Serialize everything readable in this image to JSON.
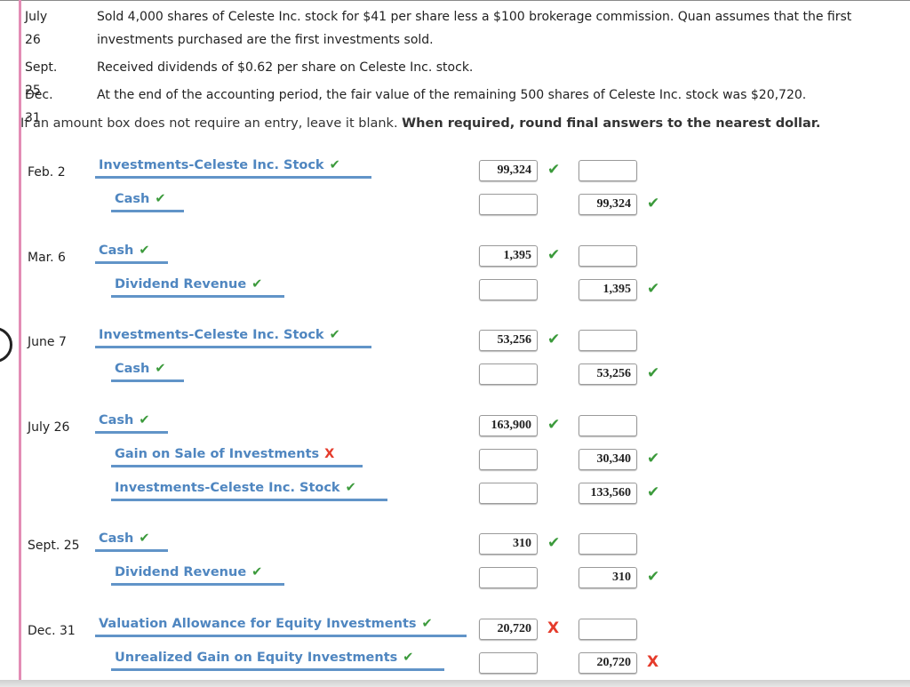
{
  "events": [
    {
      "date": "July 26",
      "text": "Sold 4,000 shares of Celeste Inc. stock for $41 per share less a $100 brokerage commission. Quan assumes that the first investments purchased are the first investments sold."
    },
    {
      "date": "Sept. 25",
      "text": "Received dividends of $0.62 per share on Celeste Inc. stock."
    },
    {
      "date": "Dec. 31",
      "text": "At the end of the accounting period, the fair value of the remaining 500 shares of Celeste Inc. stock was $20,720."
    }
  ],
  "instructions": {
    "normal": "If an amount box does not require an entry, leave it blank. ",
    "bold": "When required, round final answers to the nearest dollar."
  },
  "icons": {
    "check": "✔",
    "cross": "X"
  },
  "colors": {
    "account_text": "#4f86c0",
    "underline": "#6194c8",
    "correct": "#3b9a3b",
    "incorrect": "#e53b2b",
    "sidebar": "#e38cb5"
  },
  "journal": [
    {
      "date": "Feb. 2",
      "lines": [
        {
          "account": "Investments-Celeste Inc. Stock",
          "account_status": "correct",
          "debit": "99,324",
          "credit": "",
          "amount_status": "correct"
        },
        {
          "account": "Cash",
          "account_status": "correct",
          "debit": "",
          "credit": "99,324",
          "amount_status": "correct"
        }
      ]
    },
    {
      "date": "Mar. 6",
      "lines": [
        {
          "account": "Cash",
          "account_status": "correct",
          "debit": "1,395",
          "credit": "",
          "amount_status": "correct"
        },
        {
          "account": "Dividend Revenue",
          "account_status": "correct",
          "debit": "",
          "credit": "1,395",
          "amount_status": "correct"
        }
      ]
    },
    {
      "date": "June 7",
      "lines": [
        {
          "account": "Investments-Celeste Inc. Stock",
          "account_status": "correct",
          "debit": "53,256",
          "credit": "",
          "amount_status": "correct"
        },
        {
          "account": "Cash",
          "account_status": "correct",
          "debit": "",
          "credit": "53,256",
          "amount_status": "correct"
        }
      ]
    },
    {
      "date": "July 26",
      "lines": [
        {
          "account": "Cash",
          "account_status": "correct",
          "debit": "163,900",
          "credit": "",
          "amount_status": "correct"
        },
        {
          "account": "Gain on Sale of Investments",
          "account_status": "incorrect",
          "debit": "",
          "credit": "30,340",
          "amount_status": "correct"
        },
        {
          "account": "Investments-Celeste Inc. Stock",
          "account_status": "correct",
          "debit": "",
          "credit": "133,560",
          "amount_status": "correct"
        }
      ]
    },
    {
      "date": "Sept. 25",
      "lines": [
        {
          "account": "Cash",
          "account_status": "correct",
          "debit": "310",
          "credit": "",
          "amount_status": "correct"
        },
        {
          "account": "Dividend Revenue",
          "account_status": "correct",
          "debit": "",
          "credit": "310",
          "amount_status": "correct"
        }
      ]
    },
    {
      "date": "Dec. 31",
      "lines": [
        {
          "account": "Valuation Allowance for Equity Investments",
          "account_status": "correct",
          "debit": "20,720",
          "credit": "",
          "amount_status": "incorrect"
        },
        {
          "account": "Unrealized Gain on Equity Investments",
          "account_status": "correct",
          "debit": "",
          "credit": "20,720",
          "amount_status": "incorrect"
        }
      ]
    }
  ]
}
